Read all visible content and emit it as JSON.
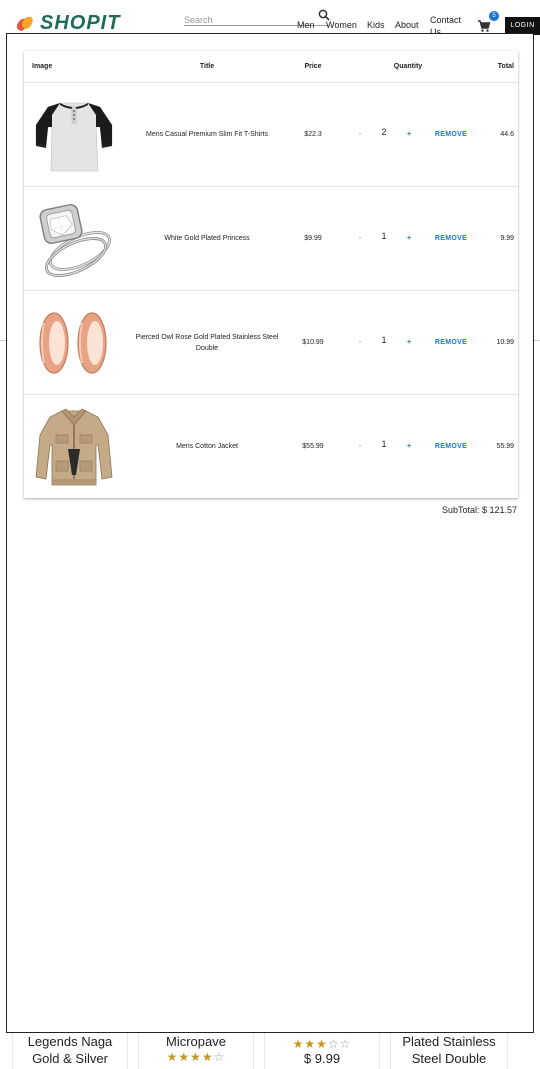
{
  "header": {
    "logo_text": "SHOPIT",
    "search_placeholder": "Search",
    "nav": [
      "Men",
      "Women",
      "Kids",
      "About",
      "Contact Us"
    ],
    "cart_count": "5",
    "login_label": "LOGIN"
  },
  "cart": {
    "columns": {
      "image": "Image",
      "title": "Title",
      "price": "Price",
      "quantity": "Quantity",
      "total": "Total"
    },
    "items": [
      {
        "title": "Mens Casual Premium Slim Fit T-Shirts",
        "price": "$22.3",
        "minus": "-",
        "quantity": "2",
        "plus": "+",
        "remove": "REMOVE",
        "total": "44.6",
        "image_icon": "tshirt-image"
      },
      {
        "title": "White Gold Plated Princess",
        "price": "$9.99",
        "minus": "-",
        "quantity": "1",
        "plus": "+",
        "remove": "REMOVE",
        "total": "9.99",
        "image_icon": "ring-image"
      },
      {
        "title": "Pierced Owl Rose Gold Plated Stainless Steel Double",
        "price": "$10.99",
        "minus": "-",
        "quantity": "1",
        "plus": "+",
        "remove": "REMOVE",
        "total": "10.99",
        "image_icon": "rose-gold-earrings-image"
      },
      {
        "title": "Mens Cotton Jacket",
        "price": "$55.99",
        "minus": "-",
        "quantity": "1",
        "plus": "+",
        "remove": "REMOVE",
        "total": "55.99",
        "image_icon": "jacket-image"
      }
    ],
    "subtotal": "SubTotal: $ 121.57"
  },
  "background_cards": [
    {
      "line1": "Legends Naga",
      "line2": "Gold & Silver"
    },
    {
      "line1": "Micropave",
      "rating": 4
    },
    {
      "rating": 3,
      "price": "$ 9.99"
    },
    {
      "line1": "Plated Stainless",
      "line2": "Steel Double"
    }
  ],
  "colors": {
    "accent": "#1976d2",
    "logo": "#1f6b5a",
    "login_bg": "#111111"
  }
}
